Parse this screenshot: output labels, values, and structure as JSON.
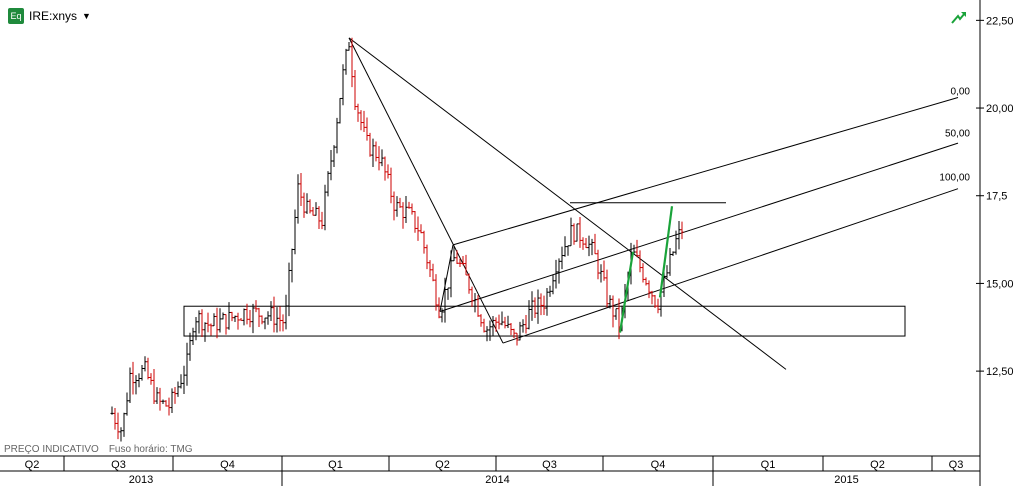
{
  "header": {
    "symbol_badge": "Eq",
    "symbol": "IRE:xnys",
    "dropdown": "▼"
  },
  "footer": {
    "price_note": "PREÇO INDICATIVO",
    "timezone": "Fuso horário: TMG"
  },
  "fib_labels": [
    "0,00",
    "50,00",
    "100,00"
  ],
  "colors": {
    "up": "#000000",
    "down": "#cc0000",
    "highlight": "#1aa33a",
    "grid": "#000000"
  },
  "chart_data": {
    "type": "ohlc",
    "x_unit": "weekly bars",
    "y_ticks": [
      {
        "v": 22.5,
        "label": "22,50"
      },
      {
        "v": 20.0,
        "label": "20,00"
      },
      {
        "v": 17.5,
        "label": "17,5"
      },
      {
        "v": 15.0,
        "label": "15,00"
      },
      {
        "v": 12.5,
        "label": "12,50"
      }
    ],
    "ylim": [
      10.08,
      23.08
    ],
    "xlim": [
      0,
      980
    ],
    "quarters": [
      {
        "label": "Q2",
        "start": 0,
        "end": 64
      },
      {
        "label": "Q3",
        "start": 64,
        "end": 173
      },
      {
        "label": "Q4",
        "start": 173,
        "end": 282
      },
      {
        "label": "Q1",
        "start": 282,
        "end": 389
      },
      {
        "label": "Q2",
        "start": 389,
        "end": 496
      },
      {
        "label": "Q3",
        "start": 496,
        "end": 603
      },
      {
        "label": "Q4",
        "start": 603,
        "end": 713
      },
      {
        "label": "Q1",
        "start": 713,
        "end": 823
      },
      {
        "label": "Q2",
        "start": 823,
        "end": 932
      },
      {
        "label": "Q3",
        "start": 932,
        "end": 980
      }
    ],
    "years": [
      {
        "label": "2013",
        "start": 0,
        "end": 282
      },
      {
        "label": "2014",
        "start": 282,
        "end": 713
      },
      {
        "label": "2015",
        "start": 713,
        "end": 980
      }
    ],
    "price_path": [
      [
        112,
        11.3
      ],
      [
        122,
        10.8
      ],
      [
        130,
        12.4
      ],
      [
        145,
        12.5
      ],
      [
        158,
        11.6
      ],
      [
        170,
        11.5
      ],
      [
        188,
        12.8
      ],
      [
        194,
        14.1
      ],
      [
        210,
        13.8
      ],
      [
        230,
        14.0
      ],
      [
        245,
        14.2
      ],
      [
        270,
        14.1
      ],
      [
        285,
        13.9
      ],
      [
        292,
        16.0
      ],
      [
        298,
        17.7
      ],
      [
        308,
        17.0
      ],
      [
        322,
        16.8
      ],
      [
        336,
        19.5
      ],
      [
        342,
        20.8
      ],
      [
        349,
        21.9
      ],
      [
        355,
        20.3
      ],
      [
        366,
        19.0
      ],
      [
        380,
        18.6
      ],
      [
        395,
        17.2
      ],
      [
        408,
        17.0
      ],
      [
        420,
        16.5
      ],
      [
        440,
        14.2
      ],
      [
        455,
        15.8
      ],
      [
        470,
        14.9
      ],
      [
        486,
        13.7
      ],
      [
        500,
        14.0
      ],
      [
        515,
        13.4
      ],
      [
        530,
        14.2
      ],
      [
        545,
        14.5
      ],
      [
        556,
        15.6
      ],
      [
        572,
        16.5
      ],
      [
        585,
        16.3
      ],
      [
        596,
        15.7
      ],
      [
        608,
        14.5
      ],
      [
        620,
        13.8
      ],
      [
        632,
        15.9
      ],
      [
        645,
        15.2
      ],
      [
        657,
        14.4
      ],
      [
        665,
        15.1
      ],
      [
        676,
        16.2
      ],
      [
        683,
        16.6
      ]
    ],
    "green_segments": [
      {
        "x1": 620,
        "y1": 13.6,
        "x2": 633,
        "y2": 15.9
      },
      {
        "x1": 660,
        "y1": 14.6,
        "x2": 672,
        "y2": 17.2
      }
    ],
    "trend_lines": [
      {
        "x1": 349,
        "y1": 22.0,
        "x2": 786,
        "y2": 12.55
      },
      {
        "x1": 349,
        "y1": 22.0,
        "x2": 503,
        "y2": 13.3
      },
      {
        "x1": 453,
        "y1": 16.1,
        "x2": 440,
        "y2": 14.2
      },
      {
        "x1": 453,
        "y1": 16.1,
        "x2": 958,
        "y2": 20.3
      },
      {
        "x1": 440,
        "y1": 14.2,
        "x2": 958,
        "y2": 19.0
      },
      {
        "x1": 503,
        "y1": 13.3,
        "x2": 958,
        "y2": 17.7
      },
      {
        "x1": 570,
        "y1": 17.3,
        "x2": 726,
        "y2": 17.3
      }
    ],
    "rectangle": {
      "x1": 184,
      "x2": 905,
      "y_top": 14.35,
      "y_bottom": 13.5
    },
    "fib_levels": [
      20.3,
      19.1,
      17.85
    ]
  }
}
